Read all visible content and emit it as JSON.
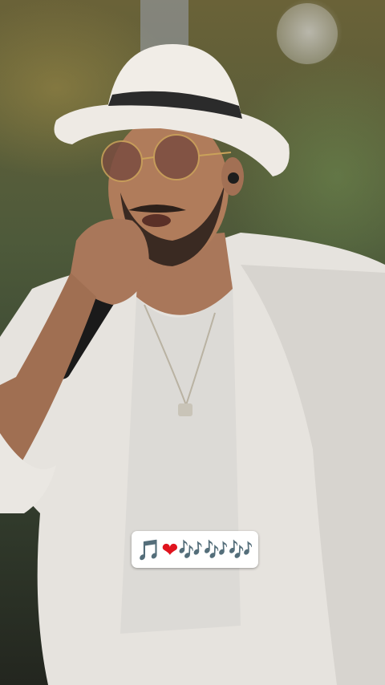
{
  "sticker": {
    "note_left": "🎵",
    "heart": "❤",
    "notes_right": "🎶🎶🎶"
  },
  "colors": {
    "sticker_background": "#ffffff",
    "heart": "#e0141e"
  },
  "icons": [
    "musical-note-icon",
    "red-heart-icon",
    "musical-notes-icon"
  ]
}
